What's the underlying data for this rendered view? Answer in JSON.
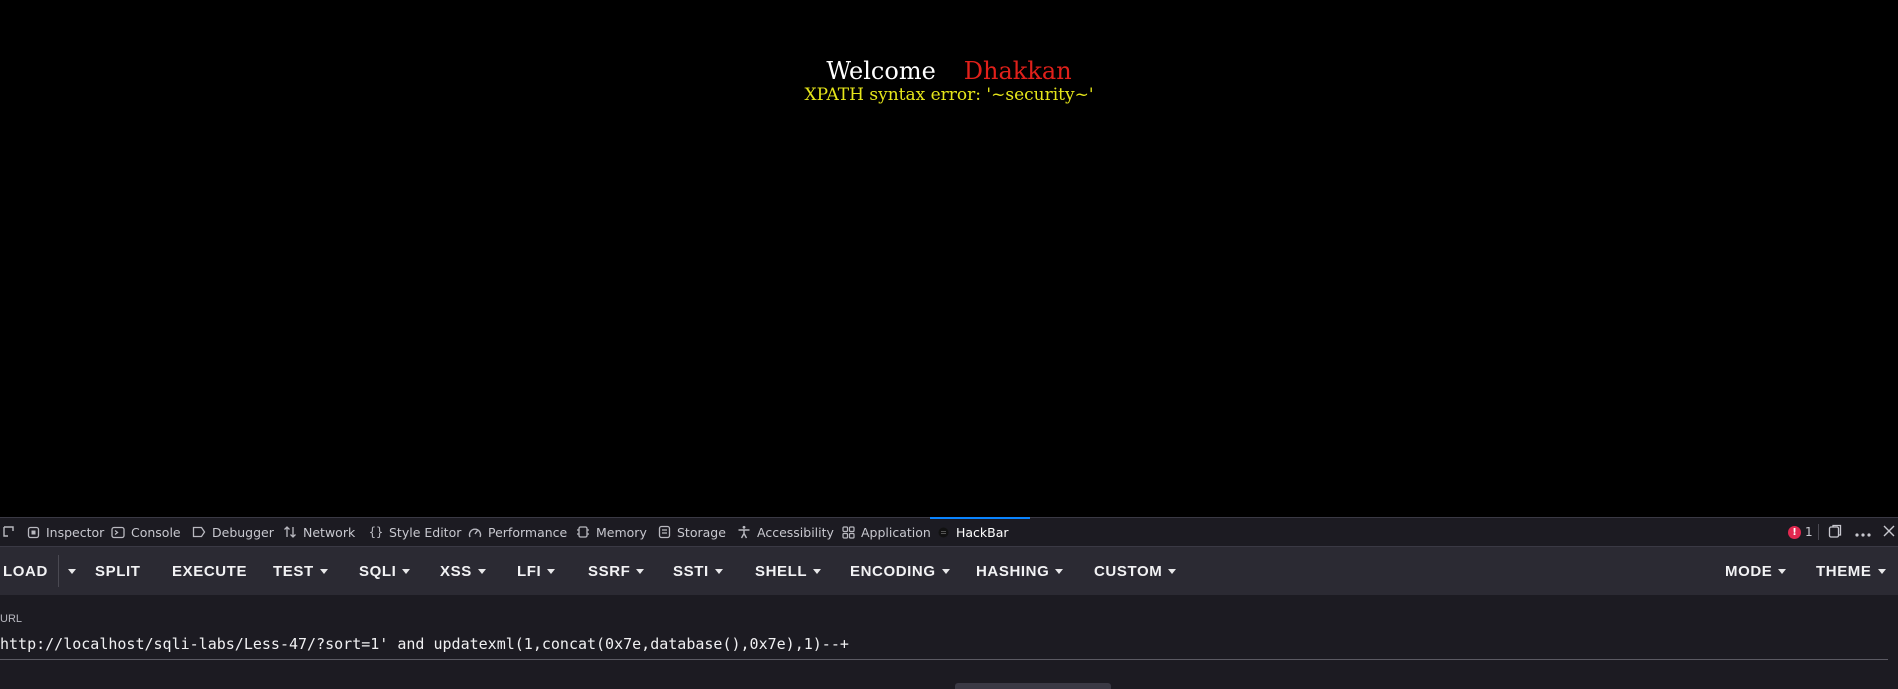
{
  "page": {
    "welcome": "Welcome",
    "user_name": "Dhakkan",
    "error_message": "XPATH syntax error: '~security~'"
  },
  "devtools": {
    "tabs": [
      {
        "label": "Inspector",
        "icon": "inspector-icon"
      },
      {
        "label": "Console",
        "icon": "console-icon"
      },
      {
        "label": "Debugger",
        "icon": "debugger-icon"
      },
      {
        "label": "Network",
        "icon": "network-icon"
      },
      {
        "label": "Style Editor",
        "icon": "style-editor-icon"
      },
      {
        "label": "Performance",
        "icon": "performance-icon"
      },
      {
        "label": "Memory",
        "icon": "memory-icon"
      },
      {
        "label": "Storage",
        "icon": "storage-icon"
      },
      {
        "label": "Accessibility",
        "icon": "accessibility-icon"
      },
      {
        "label": "Application",
        "icon": "application-icon"
      },
      {
        "label": "HackBar",
        "icon": "hackbar-icon",
        "active": true
      }
    ],
    "error_count": "1",
    "colors": {
      "active_tab": "#0a84ff",
      "error": "#e22850"
    }
  },
  "hackbar": {
    "menu": {
      "load": "LOAD",
      "split": "SPLIT",
      "execute": "EXECUTE",
      "test": "TEST",
      "sqli": "SQLI",
      "xss": "XSS",
      "lfi": "LFI",
      "ssrf": "SSRF",
      "ssti": "SSTI",
      "shell": "SHELL",
      "encoding": "ENCODING",
      "hashing": "HASHING",
      "custom": "CUSTOM",
      "mode": "MODE",
      "theme": "THEME"
    },
    "url_label": "URL",
    "url_value": "http://localhost/sqli-labs/Less-47/?sort=1' and updatexml(1,concat(0x7e,database(),0x7e),1)--+"
  }
}
